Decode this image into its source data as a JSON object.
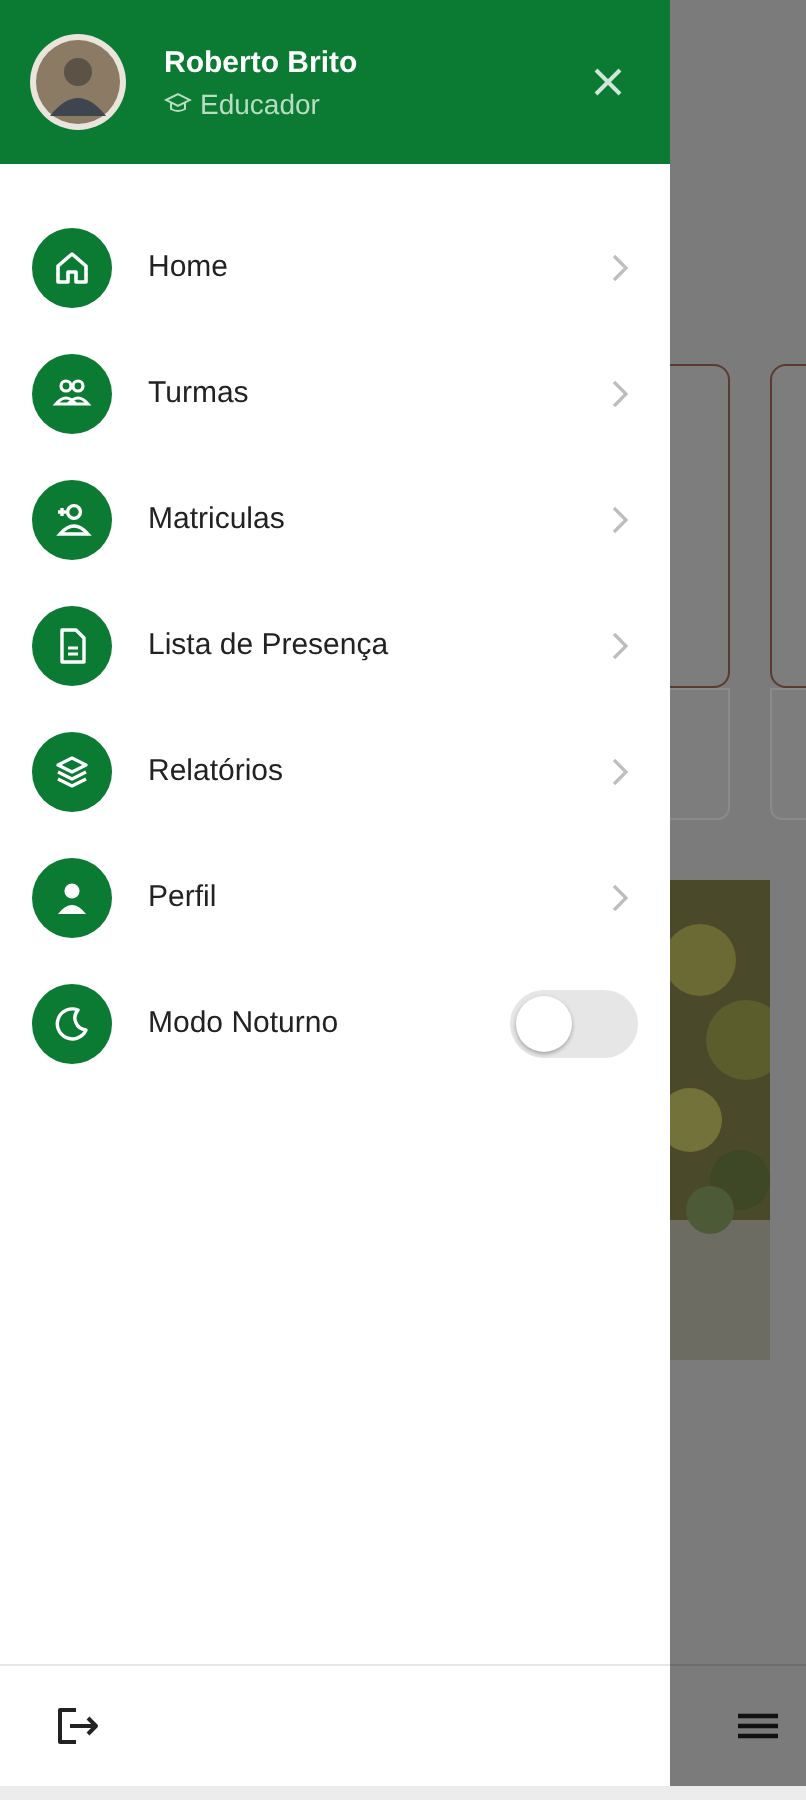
{
  "user": {
    "name": "Roberto Brito",
    "role": "Educador"
  },
  "menu": [
    {
      "kind": "link",
      "label": "Home"
    },
    {
      "kind": "link",
      "label": "Turmas"
    },
    {
      "kind": "link",
      "label": "Matriculas"
    },
    {
      "kind": "link",
      "label": "Lista de Presença"
    },
    {
      "kind": "link",
      "label": "Relatórios"
    },
    {
      "kind": "link",
      "label": "Perfil"
    },
    {
      "kind": "toggle",
      "label": "Modo Noturno",
      "on": false
    }
  ]
}
